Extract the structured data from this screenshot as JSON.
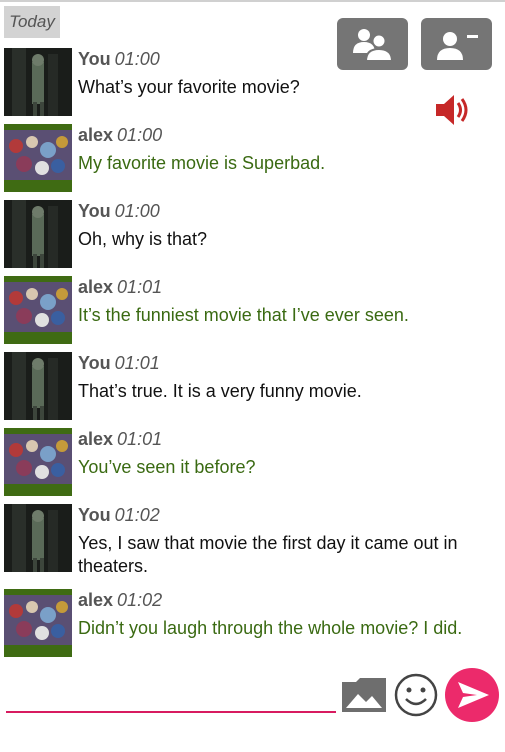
{
  "day_label": "Today",
  "icons": {
    "group": "people-icon",
    "remove_contact": "remove-contact-icon",
    "sound": "speaker-icon",
    "image": "image-icon",
    "emoji": "emoji-icon",
    "send": "send-icon"
  },
  "colors": {
    "accent": "#d81b60",
    "send_button": "#ec2a6b",
    "other_text": "#3a6a12",
    "sound_icon": "#c62828",
    "top_button": "#757575"
  },
  "messages": [
    {
      "sender": "You",
      "time": "01:00",
      "text": "What’s your favorite movie?"
    },
    {
      "sender": "alex",
      "time": "01:00",
      "text": "My favorite movie is Superbad."
    },
    {
      "sender": "You",
      "time": "01:00",
      "text": "Oh, why is that?"
    },
    {
      "sender": "alex",
      "time": "01:01",
      "text": "It’s the funniest movie that I’ve ever seen."
    },
    {
      "sender": "You",
      "time": "01:01",
      "text": "That’s true. It is a very funny movie."
    },
    {
      "sender": "alex",
      "time": "01:01",
      "text": "You’ve seen it before?"
    },
    {
      "sender": "You",
      "time": "01:02",
      "text": "Yes, I saw that movie the first day it came out in theaters."
    },
    {
      "sender": "alex",
      "time": "01:02",
      "text": "Didn’t you laugh through the whole movie? I did."
    }
  ],
  "composer": {
    "value": "",
    "placeholder": ""
  }
}
